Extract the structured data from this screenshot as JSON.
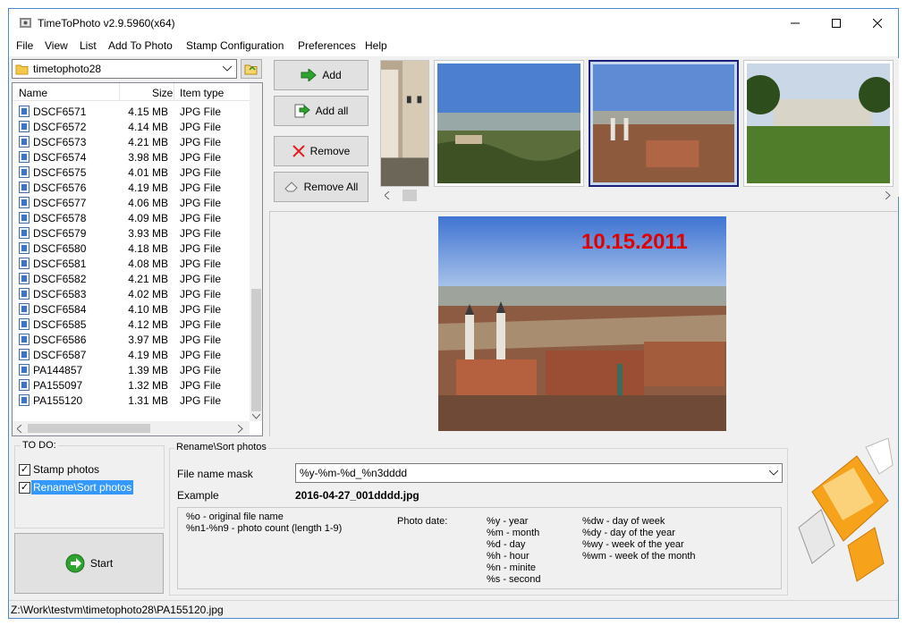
{
  "window": {
    "title": "TimeToPhoto v2.9.5960(x64)"
  },
  "menu": [
    "File",
    "View",
    "List",
    "Add To Photo",
    "Stamp Configuration",
    "Preferences",
    "Help"
  ],
  "folder": {
    "selected": "timetophoto28"
  },
  "file_list": {
    "columns": [
      "Name",
      "Size",
      "Item type"
    ],
    "rows": [
      {
        "name": "DSCF6571",
        "size": "4.15 MB",
        "type": "JPG File"
      },
      {
        "name": "DSCF6572",
        "size": "4.14 MB",
        "type": "JPG File"
      },
      {
        "name": "DSCF6573",
        "size": "4.21 MB",
        "type": "JPG File"
      },
      {
        "name": "DSCF6574",
        "size": "3.98 MB",
        "type": "JPG File"
      },
      {
        "name": "DSCF6575",
        "size": "4.01 MB",
        "type": "JPG File"
      },
      {
        "name": "DSCF6576",
        "size": "4.19 MB",
        "type": "JPG File"
      },
      {
        "name": "DSCF6577",
        "size": "4.06 MB",
        "type": "JPG File"
      },
      {
        "name": "DSCF6578",
        "size": "4.09 MB",
        "type": "JPG File"
      },
      {
        "name": "DSCF6579",
        "size": "3.93 MB",
        "type": "JPG File"
      },
      {
        "name": "DSCF6580",
        "size": "4.18 MB",
        "type": "JPG File"
      },
      {
        "name": "DSCF6581",
        "size": "4.08 MB",
        "type": "JPG File"
      },
      {
        "name": "DSCF6582",
        "size": "4.21 MB",
        "type": "JPG File"
      },
      {
        "name": "DSCF6583",
        "size": "4.02 MB",
        "type": "JPG File"
      },
      {
        "name": "DSCF6584",
        "size": "4.10 MB",
        "type": "JPG File"
      },
      {
        "name": "DSCF6585",
        "size": "4.12 MB",
        "type": "JPG File"
      },
      {
        "name": "DSCF6586",
        "size": "3.97 MB",
        "type": "JPG File"
      },
      {
        "name": "DSCF6587",
        "size": "4.19 MB",
        "type": "JPG File"
      },
      {
        "name": "PA144857",
        "size": "1.39 MB",
        "type": "JPG File"
      },
      {
        "name": "PA155097",
        "size": "1.32 MB",
        "type": "JPG File"
      },
      {
        "name": "PA155120",
        "size": "1.31 MB",
        "type": "JPG File"
      }
    ]
  },
  "buttons": {
    "add": "Add",
    "add_all": "Add all",
    "remove": "Remove",
    "remove_all": "Remove All",
    "start": "Start"
  },
  "preview": {
    "stamp_text": "10.15.2011"
  },
  "todo": {
    "label": "TO DO:",
    "items": [
      {
        "label": "Stamp photos",
        "checked": true,
        "mark": "✓"
      },
      {
        "label": "Rename\\Sort photos",
        "checked": true,
        "mark": "✓"
      }
    ]
  },
  "rename": {
    "group_label": "Rename\\Sort photos",
    "mask_label": "File name mask",
    "mask_value": "%y-%m-%d_%n3dddd",
    "example_label": "Example",
    "example_value": "2016-04-27_001dddd.jpg",
    "help": {
      "original": "%o - original file name",
      "count": "%n1-%n9 - photo count (length  1-9)",
      "photo_date_label": "Photo date:",
      "col1": [
        "%y - year",
        "%m - month",
        "%d - day",
        "%h - hour",
        "%n - minite",
        "%s - second"
      ],
      "col2": [
        "%dw - day of week",
        "%dy - day of the year",
        "%wy - week of the year",
        "%wm - week of the month"
      ]
    }
  },
  "status": {
    "path": "Z:\\Work\\testvm\\timetophoto28\\PA155120.jpg"
  }
}
